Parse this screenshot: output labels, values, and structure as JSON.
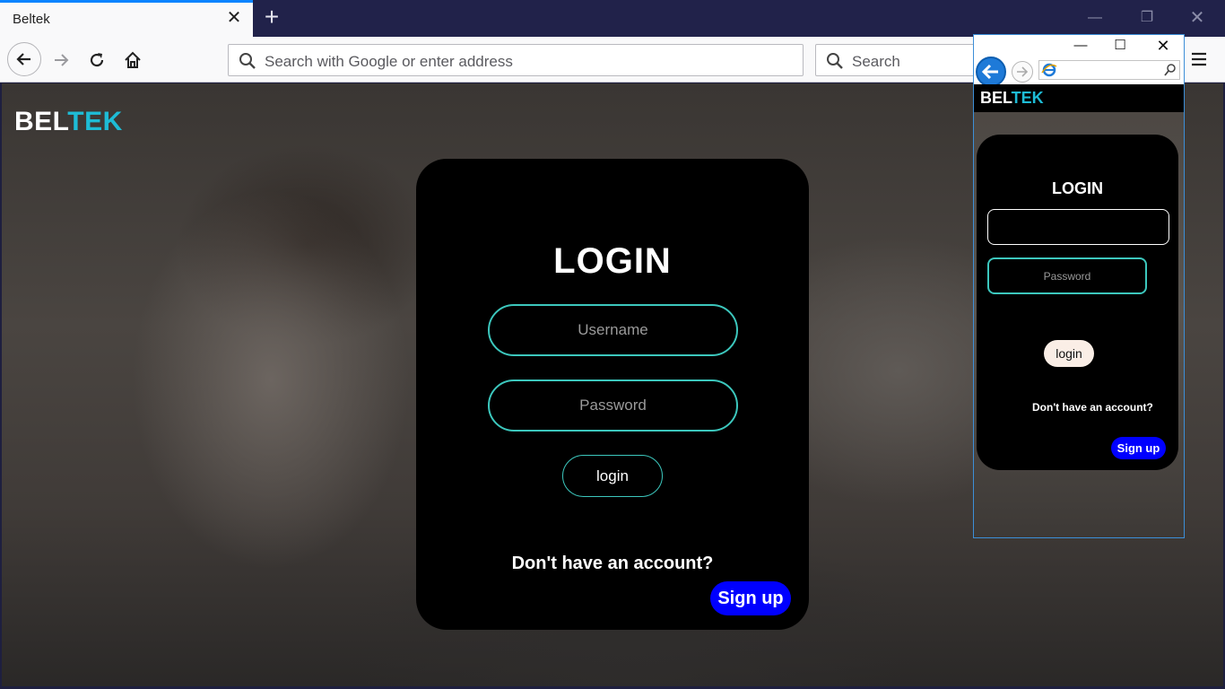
{
  "browser": {
    "tab_title": "Beltek",
    "url_placeholder": "Search with Google or enter address",
    "search_placeholder": "Search"
  },
  "page": {
    "brand_part1": "BEL",
    "brand_part2": "TEK",
    "login": {
      "title": "LOGIN",
      "username_placeholder": "Username",
      "password_placeholder": "Password",
      "login_label": "login",
      "no_account_text": "Don't have an account?",
      "signup_label": "Sign up"
    }
  },
  "ie_window": {
    "brand_part1": "BEL",
    "brand_part2": "TEK",
    "title": "LOGIN",
    "password_placeholder": "Password",
    "login_label": "login",
    "no_account_text": "Don't have an account?",
    "signup_label": "Sign up"
  },
  "colors": {
    "accent_teal": "#3cc7bd",
    "brand_cyan": "#1ebcd6",
    "signup_blue": "#0000ff"
  }
}
